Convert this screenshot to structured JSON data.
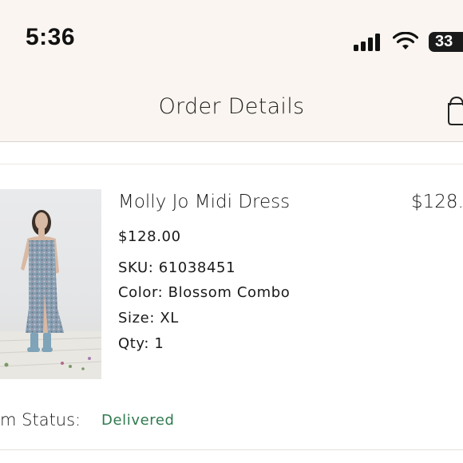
{
  "status_bar": {
    "time": "5:36",
    "battery_level": "33",
    "icons": [
      "signal-icon",
      "wifi-icon",
      "battery-icon"
    ]
  },
  "header": {
    "title": "Order Details",
    "right_icon": "shopping-bag-icon"
  },
  "colors": {
    "header_background": "#faf5f0",
    "status_delivered": "#2f7a50",
    "text": "#1a1a1a"
  },
  "order_item": {
    "name": "Molly Jo Midi Dress",
    "line_total": "$128.",
    "price": "$128.00",
    "sku": "SKU: 61038451",
    "color": "Color: Blossom Combo",
    "size": "Size: XL",
    "qty": "Qty: 1",
    "image_alt": "Model wearing floral midi dress with blue rain boots"
  },
  "status": {
    "label": "m Status:",
    "value": "Delivered"
  }
}
